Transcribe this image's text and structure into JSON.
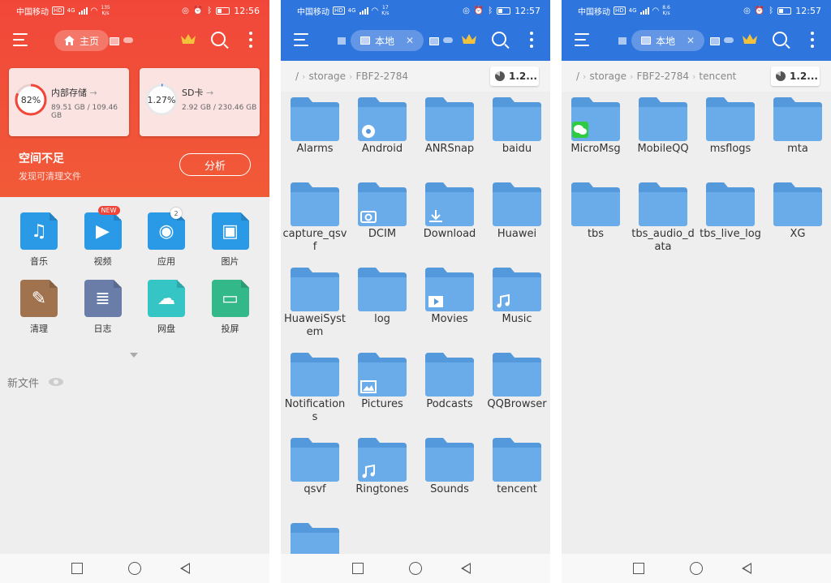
{
  "colors": {
    "red_header": "#f1473a",
    "blue_header": "#2f75de",
    "folder": "#6aace9",
    "folder_dark": "#5599dd"
  },
  "panels": [
    {
      "status": {
        "carrier": "中国移动",
        "hd": "HD",
        "net": "4G",
        "speed_value": "135",
        "speed_unit": "K/s",
        "time": "12:56"
      },
      "tab_label": "主页",
      "storage": [
        {
          "name": "内部存储",
          "percent": "82%",
          "percent_value": 82,
          "size": "89.51 GB / 109.46 GB"
        },
        {
          "name": "SD卡",
          "percent": "1.27%",
          "percent_value": 1.27,
          "size": "2.92 GB / 230.46 GB"
        }
      ],
      "warning_title": "空间不足",
      "warning_sub": "发现可清理文件",
      "analyze_label": "分析",
      "categories": [
        {
          "label": "音乐",
          "icon": "music-icon",
          "color": "#2a9ae6"
        },
        {
          "label": "视频",
          "icon": "video-icon",
          "color": "#2a9ae6",
          "badge": "NEW"
        },
        {
          "label": "应用",
          "icon": "android-icon",
          "color": "#2a9ae6",
          "badge": "2"
        },
        {
          "label": "图片",
          "icon": "image-icon",
          "color": "#2a9ae6"
        },
        {
          "label": "清理",
          "icon": "broom-icon",
          "color": "#a0724e"
        },
        {
          "label": "日志",
          "icon": "log-icon",
          "color": "#6a7ca8"
        },
        {
          "label": "网盘",
          "icon": "cloud-icon",
          "color": "#35c5c5"
        },
        {
          "label": "投屏",
          "icon": "cast-icon",
          "color": "#33b88a"
        }
      ],
      "new_files_label": "新文件"
    },
    {
      "status": {
        "carrier": "中国移动",
        "hd": "HD",
        "net": "4G",
        "speed_value": "17",
        "speed_unit": "K/s",
        "time": "12:57"
      },
      "tab_label": "本地",
      "crumbs": [
        "/",
        "storage",
        "FBF2-2784"
      ],
      "usage": "1.2...",
      "folders": [
        {
          "name": "Alarms"
        },
        {
          "name": "Android",
          "overlay": "gear"
        },
        {
          "name": "ANRSnap"
        },
        {
          "name": "baidu"
        },
        {
          "name": "capture_qsvf"
        },
        {
          "name": "DCIM",
          "overlay": "camera"
        },
        {
          "name": "Download",
          "overlay": "download"
        },
        {
          "name": "Huawei"
        },
        {
          "name": "HuaweiSystem"
        },
        {
          "name": "log"
        },
        {
          "name": "Movies",
          "overlay": "play"
        },
        {
          "name": "Music",
          "overlay": "note"
        },
        {
          "name": "Notifications"
        },
        {
          "name": "Pictures",
          "overlay": "picture"
        },
        {
          "name": "Podcasts"
        },
        {
          "name": "QQBrowser"
        },
        {
          "name": "qsvf"
        },
        {
          "name": "Ringtones",
          "overlay": "note"
        },
        {
          "name": "Sounds"
        },
        {
          "name": "tencent"
        },
        {
          "name": ""
        }
      ]
    },
    {
      "status": {
        "carrier": "中国移动",
        "hd": "HD",
        "net": "4G",
        "speed_value": "8.6",
        "speed_unit": "K/s",
        "time": "12:57"
      },
      "tab_label": "本地",
      "crumbs": [
        "/",
        "storage",
        "FBF2-2784",
        "tencent"
      ],
      "usage": "1.2...",
      "folders": [
        {
          "name": "MicroMsg",
          "overlay": "wechat"
        },
        {
          "name": "MobileQQ"
        },
        {
          "name": "msflogs"
        },
        {
          "name": "mta"
        },
        {
          "name": "tbs"
        },
        {
          "name": "tbs_audio_data"
        },
        {
          "name": "tbs_live_log"
        },
        {
          "name": "XG"
        }
      ]
    }
  ]
}
